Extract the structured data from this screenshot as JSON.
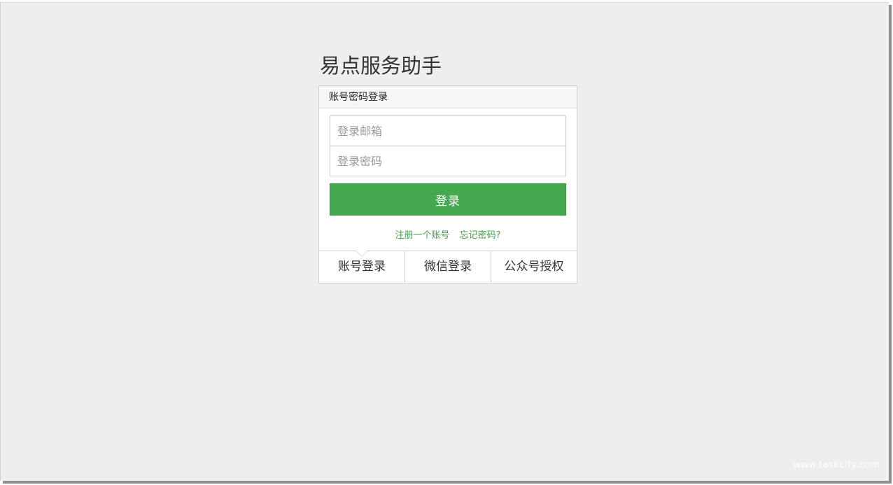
{
  "app": {
    "title": "易点服务助手"
  },
  "login_panel": {
    "header": "账号密码登录",
    "email_placeholder": "登录邮箱",
    "password_placeholder": "登录密码",
    "submit_label": "登录",
    "register_link": "注册一个账号",
    "forgot_link": "忘记密码?"
  },
  "tabs": [
    {
      "label": "账号登录",
      "active": true
    },
    {
      "label": "微信登录",
      "active": false
    },
    {
      "label": "公众号授权",
      "active": false
    }
  ],
  "watermark": "www.taskcity.com",
  "colors": {
    "accent": "#45aa4f",
    "link": "#3f9f4b",
    "background": "#eeeeee"
  }
}
